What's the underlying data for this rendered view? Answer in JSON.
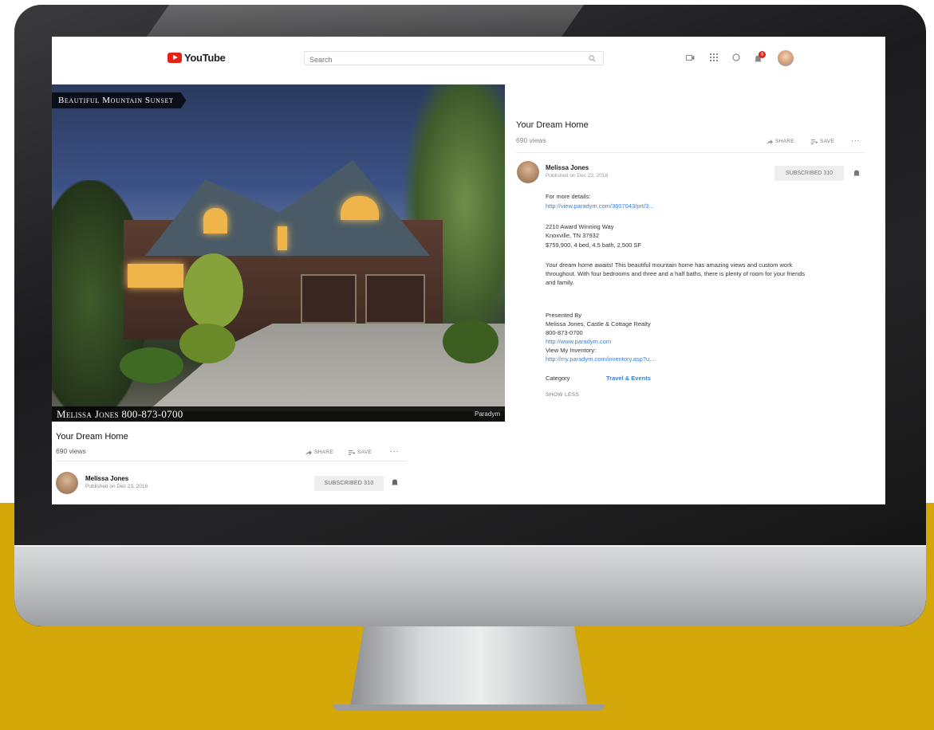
{
  "header": {
    "logo_text": "YouTube",
    "search_placeholder": "Search",
    "notification_count": "9"
  },
  "video": {
    "overlay_title": "Beautiful Mountain Sunset",
    "overlay_contact": "Melissa Jones 800-873-0700",
    "overlay_brand": "Paradym"
  },
  "left_info": {
    "title": "Your Dream Home",
    "views": "690 views",
    "share_label": "SHARE",
    "save_label": "SAVE",
    "more_label": "···",
    "channel_name": "Melissa Jones",
    "published": "Published on Dec 23, 2018",
    "subscribed_label": "SUBSCRIBED  310"
  },
  "right_info": {
    "title": "Your Dream Home",
    "views": "690 views",
    "share_label": "SHARE",
    "save_label": "SAVE",
    "more_label": "···",
    "channel_name": "Melissa Jones",
    "published": "Published on Dec 23, 2018",
    "subscribed_label": "SUBSCRIBED  310",
    "description": {
      "details_label": "For more details:",
      "details_link": "http://view.paradym.com/3607043/prt/3...",
      "address_line1": "2210 Award Winning Way",
      "address_line2": "Knoxville, TN 37932",
      "price_line": "$759,900, 4 bed, 4.5 bath, 2,500 SF",
      "body_line1": "Your dream home awaits! This beautiful mountain home has amazing views and custom work",
      "body_line2": "throughout. With four bedrooms and three and a half baths, there is plenty of room for your friends",
      "body_line3": "and family.",
      "presented_by": "Presented By",
      "agent_line": "Melissa Jones, Castle & Cottage Realty",
      "phone": "800-873-0700",
      "website": "http://www.paradym.com",
      "inventory_label": "View My Inventory:",
      "inventory_link": "http://my.paradym.com/inventory.asp?u...",
      "category_label": "Category",
      "category_value": "Travel & Events",
      "show_less": "SHOW LESS"
    }
  },
  "icons": {
    "menu": "menu-icon",
    "search": "search-icon",
    "create_video": "video-camera-icon",
    "apps": "apps-grid-icon",
    "messages": "chat-icon",
    "notifications": "bell-icon",
    "share": "share-arrow-icon",
    "save": "playlist-add-icon",
    "more": "more-dots-icon"
  },
  "colors": {
    "youtube_red": "#e62117",
    "link_blue": "#3b7fd1",
    "background_gold": "#d3a707"
  }
}
